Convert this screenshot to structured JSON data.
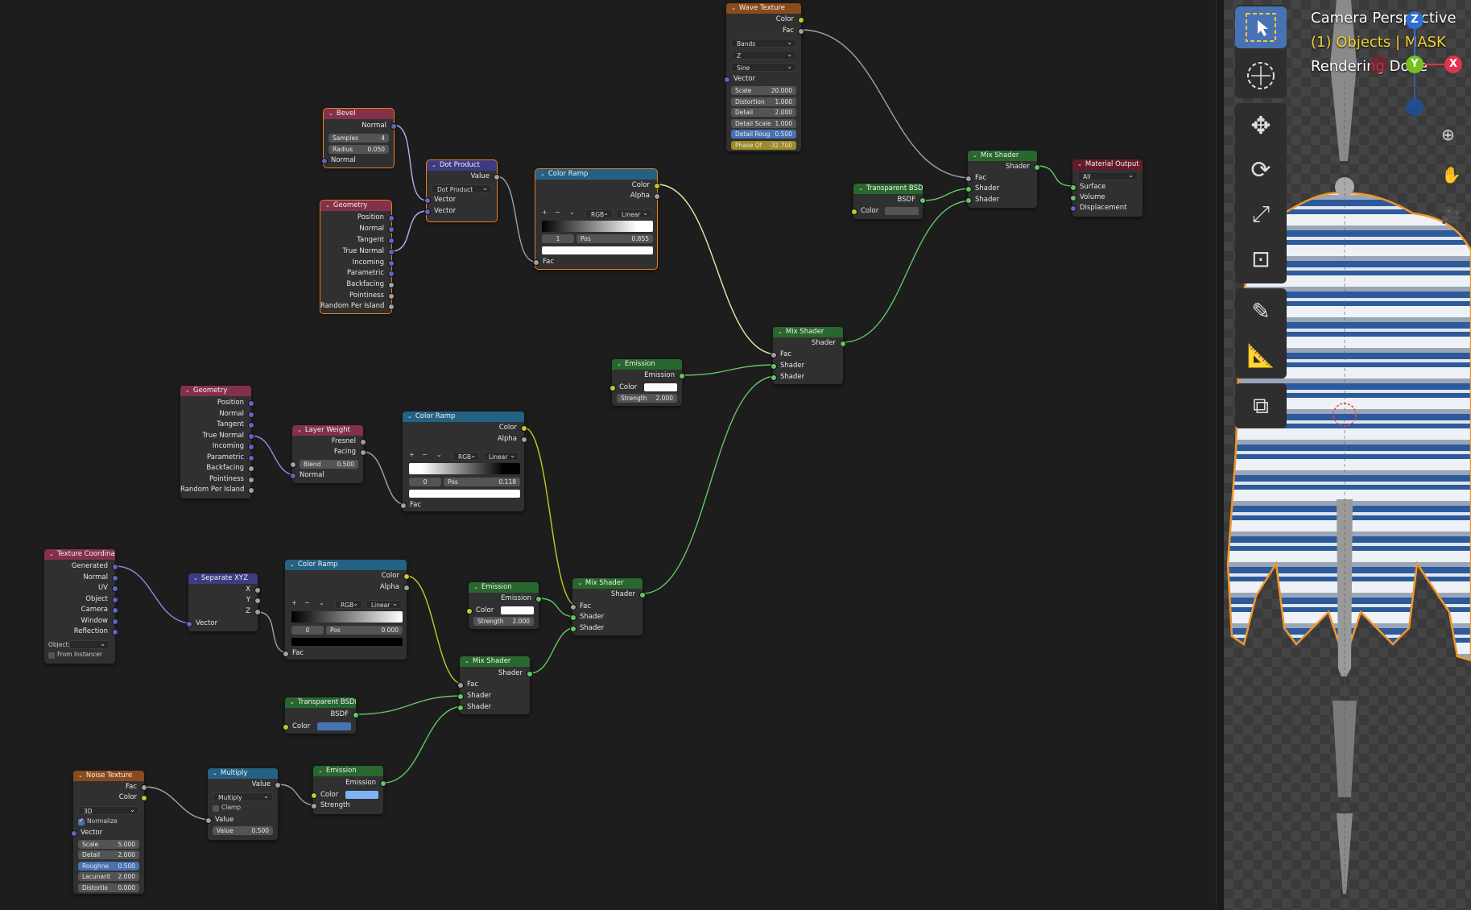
{
  "nodes": {
    "wave": {
      "title": "Wave Texture",
      "out1": "Color",
      "out2": "Fac",
      "type": "Bands",
      "dir": "Z",
      "profile": "Sine",
      "vector": "Vector",
      "f1l": "Scale",
      "f1v": "20.000",
      "f2l": "Distortion",
      "f2v": "1.000",
      "f3l": "Detail",
      "f3v": "2.000",
      "f4l": "Detail Scale",
      "f4v": "1.000",
      "f5l": "Detail Roug",
      "f5v": "0.500",
      "f6l": "Phase Of",
      "f6v": "-32.700"
    },
    "bevel": {
      "title": "Bevel",
      "out": "Normal",
      "samples_l": "Samples",
      "samples_v": "4",
      "radius_l": "Radius",
      "radius_v": "0.050",
      "in": "Normal"
    },
    "dot": {
      "title": "Dot Product",
      "out": "Value",
      "op": "Dot Product",
      "in1": "Vector",
      "in2": "Vector"
    },
    "geo1": {
      "title": "Geometry",
      "outs": [
        "Position",
        "Normal",
        "Tangent",
        "True Normal",
        "Incoming",
        "Parametric",
        "Backfacing",
        "Pointiness",
        "Random Per Island"
      ]
    },
    "ramp1": {
      "title": "Color Ramp",
      "out1": "Color",
      "out2": "Alpha",
      "plus": "+",
      "minus": "−",
      "mode": "RGB",
      "interp": "Linear",
      "idx": "1",
      "pos_l": "Pos",
      "pos_v": "0.855",
      "in": "Fac"
    },
    "transp1": {
      "title": "Transparent BSDF",
      "out": "BSDF",
      "in": "Color"
    },
    "mix1": {
      "title": "Mix Shader",
      "out": "Shader",
      "in1": "Fac",
      "in2": "Shader",
      "in3": "Shader"
    },
    "matout": {
      "title": "Material Output",
      "target": "All",
      "in1": "Surface",
      "in2": "Volume",
      "in3": "Displacement"
    },
    "mix2": {
      "title": "Mix Shader",
      "out": "Shader",
      "in1": "Fac",
      "in2": "Shader",
      "in3": "Shader"
    },
    "emis1": {
      "title": "Emission",
      "out": "Emission",
      "in1": "Color",
      "str_l": "Strength",
      "str_v": "2.000"
    },
    "geo2": {
      "title": "Geometry",
      "outs": [
        "Position",
        "Normal",
        "Tangent",
        "True Normal",
        "Incoming",
        "Parametric",
        "Backfacing",
        "Pointiness",
        "Random Per Island"
      ]
    },
    "layer": {
      "title": "Layer Weight",
      "out1": "Fresnel",
      "out2": "Facing",
      "blend_l": "Blend",
      "blend_v": "0.500",
      "in": "Normal"
    },
    "ramp2": {
      "title": "Color Ramp",
      "out1": "Color",
      "out2": "Alpha",
      "plus": "+",
      "minus": "−",
      "mode": "RGB",
      "interp": "Linear",
      "idx": "0",
      "pos_l": "Pos",
      "pos_v": "0.118",
      "in": "Fac"
    },
    "texco": {
      "title": "Texture Coordinate",
      "outs": [
        "Generated",
        "Normal",
        "UV",
        "Object",
        "Camera",
        "Window",
        "Reflection"
      ],
      "obj": "Object:",
      "inst": "From Instancer"
    },
    "sep": {
      "title": "Separate XYZ",
      "out1": "X",
      "out2": "Y",
      "out3": "Z",
      "in": "Vector"
    },
    "ramp3": {
      "title": "Color Ramp",
      "out1": "Color",
      "out2": "Alpha",
      "plus": "+",
      "minus": "−",
      "mode": "RGB",
      "interp": "Linear",
      "idx": "0",
      "pos_l": "Pos",
      "pos_v": "0.000",
      "in": "Fac"
    },
    "emis2": {
      "title": "Emission",
      "out": "Emission",
      "in1": "Color",
      "str_l": "Strength",
      "str_v": "2.000"
    },
    "mix3": {
      "title": "Mix Shader",
      "out": "Shader",
      "in1": "Fac",
      "in2": "Shader",
      "in3": "Shader"
    },
    "mix4": {
      "title": "Mix Shader",
      "out": "Shader",
      "in1": "Fac",
      "in2": "Shader",
      "in3": "Shader"
    },
    "transp2": {
      "title": "Transparent BSDF",
      "out": "BSDF",
      "in": "Color"
    },
    "noise": {
      "title": "Noise Texture",
      "out1": "Fac",
      "out2": "Color",
      "dim": "3D",
      "norm": "Normalize",
      "vector": "Vector",
      "f1l": "Scale",
      "f1v": "5.000",
      "f2l": "Detail",
      "f2v": "2.000",
      "f3l": "Roughne",
      "f3v": "0.500",
      "f4l": "Lacunarit",
      "f4v": "2.000",
      "f5l": "Distortio",
      "f5v": "0.000"
    },
    "mult": {
      "title": "Multiply",
      "out": "Value",
      "op": "Multiply",
      "clamp": "Clamp",
      "in1": "Value",
      "val_l": "Value",
      "val_v": "0.500"
    },
    "emis3": {
      "title": "Emission",
      "out": "Emission",
      "in1": "Color",
      "in2": "Strength"
    }
  },
  "viewport": {
    "line1": "Camera Perspective",
    "line2": "(1) Objects | MASK",
    "line3": "Rendering Done",
    "axis_x": "X",
    "axis_y": "Y",
    "axis_z": "Z"
  },
  "colors": {
    "header_texture": "#8a4a1c",
    "header_input": "#83314a",
    "header_vector": "#3c3c83",
    "header_converter": "#246283",
    "header_shader": "#28672d",
    "header_output": "#641c2b"
  }
}
